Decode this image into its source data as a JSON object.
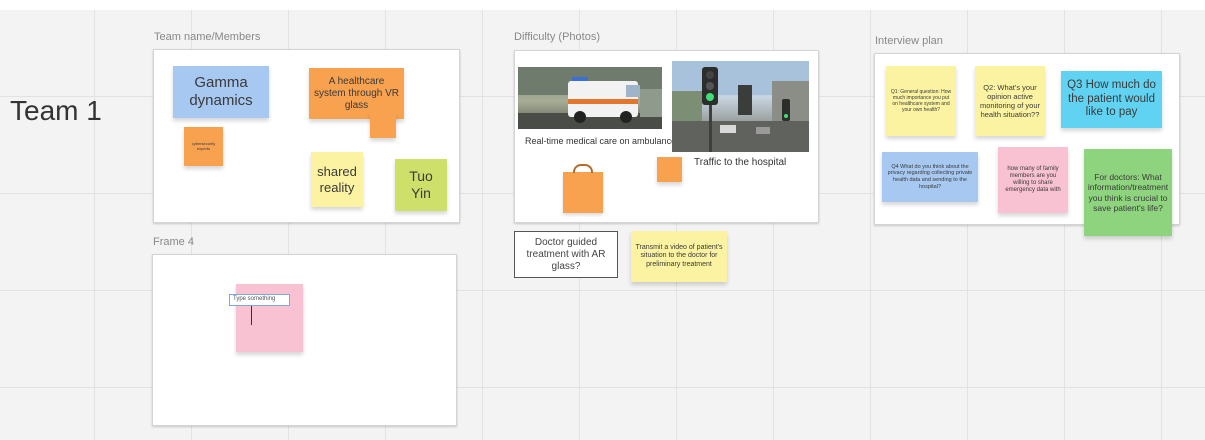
{
  "board": {
    "team_title": "Team 1",
    "colors": {
      "orange": "#f8a14f",
      "blue": "#a7c8f0",
      "cyan": "#61d3f2",
      "yellow": "#fbf3a1",
      "lime": "#cfe06a",
      "pink": "#f8c2d2",
      "green": "#8ed47e"
    }
  },
  "frames": {
    "team": {
      "label": "Team name/Members",
      "notes": {
        "gamma": "Gamma dynamics",
        "healthcare": "A healthcare system through VR glass",
        "cyber": "cybersecurity experts",
        "shared": "shared reality",
        "tuo": "Tuo Yin"
      }
    },
    "difficulty": {
      "label": "Difficulty (Photos)",
      "photo1_caption": "Real-time medical care on ambulance",
      "photo2_caption": "Traffic to the hospital"
    },
    "interview": {
      "label": "Interview plan",
      "q1": "Q1: General question: How much importance you put on healthcare system and your own health?",
      "q2": "Q2: What's your opinion active monitoring of your health situation??",
      "q3": "Q3 How much do the patient would like to pay",
      "q4": "Q4 What do you think about the privacy regarding collecting private health data and sending to the hospital?",
      "family": "how many of family members are you willing to share emergency data with",
      "doctors": "For doctors: What information/treatment you think is crucial to save patient's life?"
    },
    "frame4": {
      "label": "Frame 4",
      "input_placeholder": "Type something"
    }
  },
  "loose_notes": {
    "doctor_guided": "Doctor guided treatment with AR glass?",
    "transmit": "Transmit a video of patient's situation to the doctor for preliminary treatment"
  }
}
